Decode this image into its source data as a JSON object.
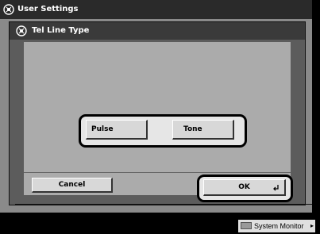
{
  "header": {
    "title": "User Settings"
  },
  "dialog": {
    "title": "Tel Line Type",
    "options": [
      "Pulse",
      "Tone"
    ],
    "cancel_label": "Cancel",
    "ok_label": "OK"
  },
  "footer": {
    "system_monitor_label": "System Monitor",
    "arrow": "▸"
  }
}
